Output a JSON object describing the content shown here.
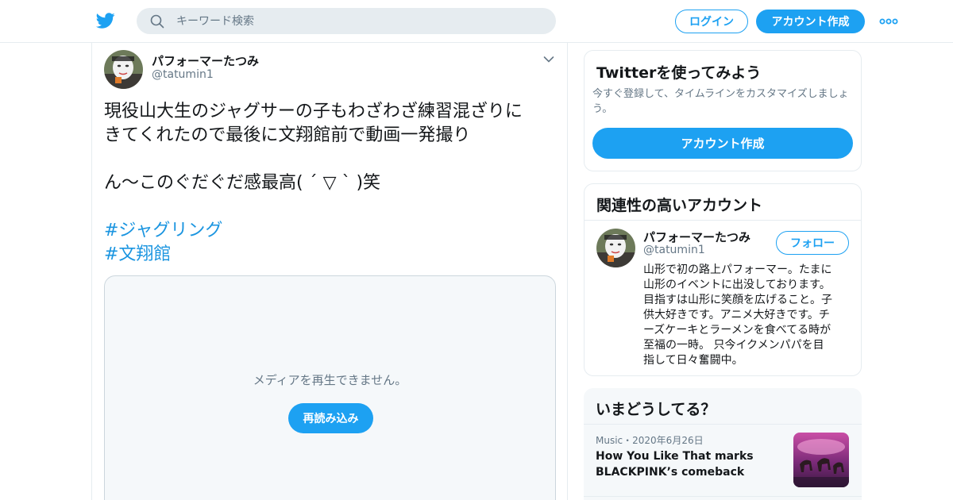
{
  "header": {
    "search_placeholder": "キーワード検索",
    "login_label": "ログイン",
    "signup_label": "アカウント作成",
    "logo_icon": "twitter-bird-icon",
    "more_icon": "more-dots-icon"
  },
  "tweet": {
    "author_name": "パフォーマーたつみ",
    "author_handle": "@tatumin1",
    "text_lines": [
      "現役山大生のジャグサーの子もわざわざ練習混ざりに",
      "きてくれたので最後に文翔館前で動画一発撮り",
      "",
      "ん〜このぐだぐだ感最高( ´ ▽ ` )笑",
      ""
    ],
    "hashtags": [
      "#ジャグリング",
      "#文翔館"
    ],
    "media_message": "メディアを再生できません。",
    "reload_label": "再読み込み"
  },
  "sidebar": {
    "signup_card": {
      "title": "Twitterを使ってみよう",
      "subtitle_lines": [
        "今すぐ登録して、タイムラインをカスタマイズしましょ",
        "う。"
      ],
      "button_label": "アカウント作成"
    },
    "related": {
      "title": "関連性の高いアカウント",
      "name": "パフォーマーたつみ",
      "handle": "@tatumin1",
      "follow_label": "フォロー",
      "bio_lines": [
        "山形で初の路上パフォーマー。たまに",
        "山形のイベントに出没しております。",
        "目指すは山形に笑顔を広げること。子",
        "供大好きです。アニメ大好きです。チ",
        "ーズケーキとラーメンを食べてる時が",
        "至福の一時。 只今イクメンパパを目",
        "指して日々奮闘中。"
      ]
    },
    "trends": {
      "title": "いまどうしてる？",
      "item_meta": "Music・2020年6月26日",
      "item_title": "How You Like That marks BLACKPINK’s comeback"
    }
  },
  "colors": {
    "brand": "#1da1f2",
    "hashtag": "#1b95e0",
    "secondary_text": "#657786",
    "border": "#e6ecf0"
  }
}
